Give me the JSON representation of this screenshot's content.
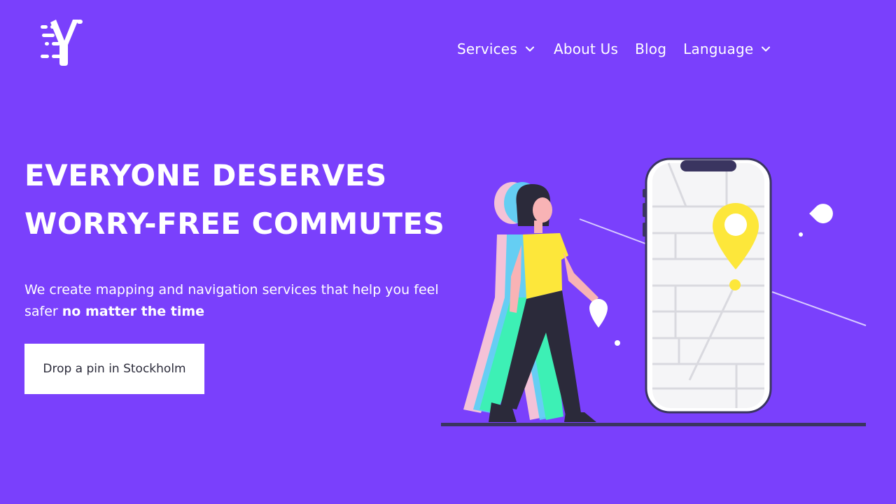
{
  "header": {
    "logo_icon": "fast-y-logo-icon",
    "nav": [
      {
        "label": "Services",
        "has_dropdown": true
      },
      {
        "label": "About Us",
        "has_dropdown": false
      },
      {
        "label": "Blog",
        "has_dropdown": false
      },
      {
        "label": "Language",
        "has_dropdown": true
      }
    ]
  },
  "hero": {
    "title_line1": "EVERYONE DESERVES",
    "title_line2": "WORRY-FREE COMMUTES",
    "subtitle_part1": "We create mapping and navigation services that help you feel safer ",
    "subtitle_bold": "no matter the time",
    "cta_label": "Drop a pin in Stockholm"
  },
  "illustration": {
    "name": "woman-walking-with-phone-map-illustration",
    "icons": [
      "map-pin-icon",
      "phone-icon"
    ]
  },
  "colors": {
    "background": "#7a40fc",
    "accent_yellow": "#fde73a",
    "text": "#ffffff",
    "cta_bg": "#ffffff",
    "cta_text": "#2b2b3a"
  }
}
